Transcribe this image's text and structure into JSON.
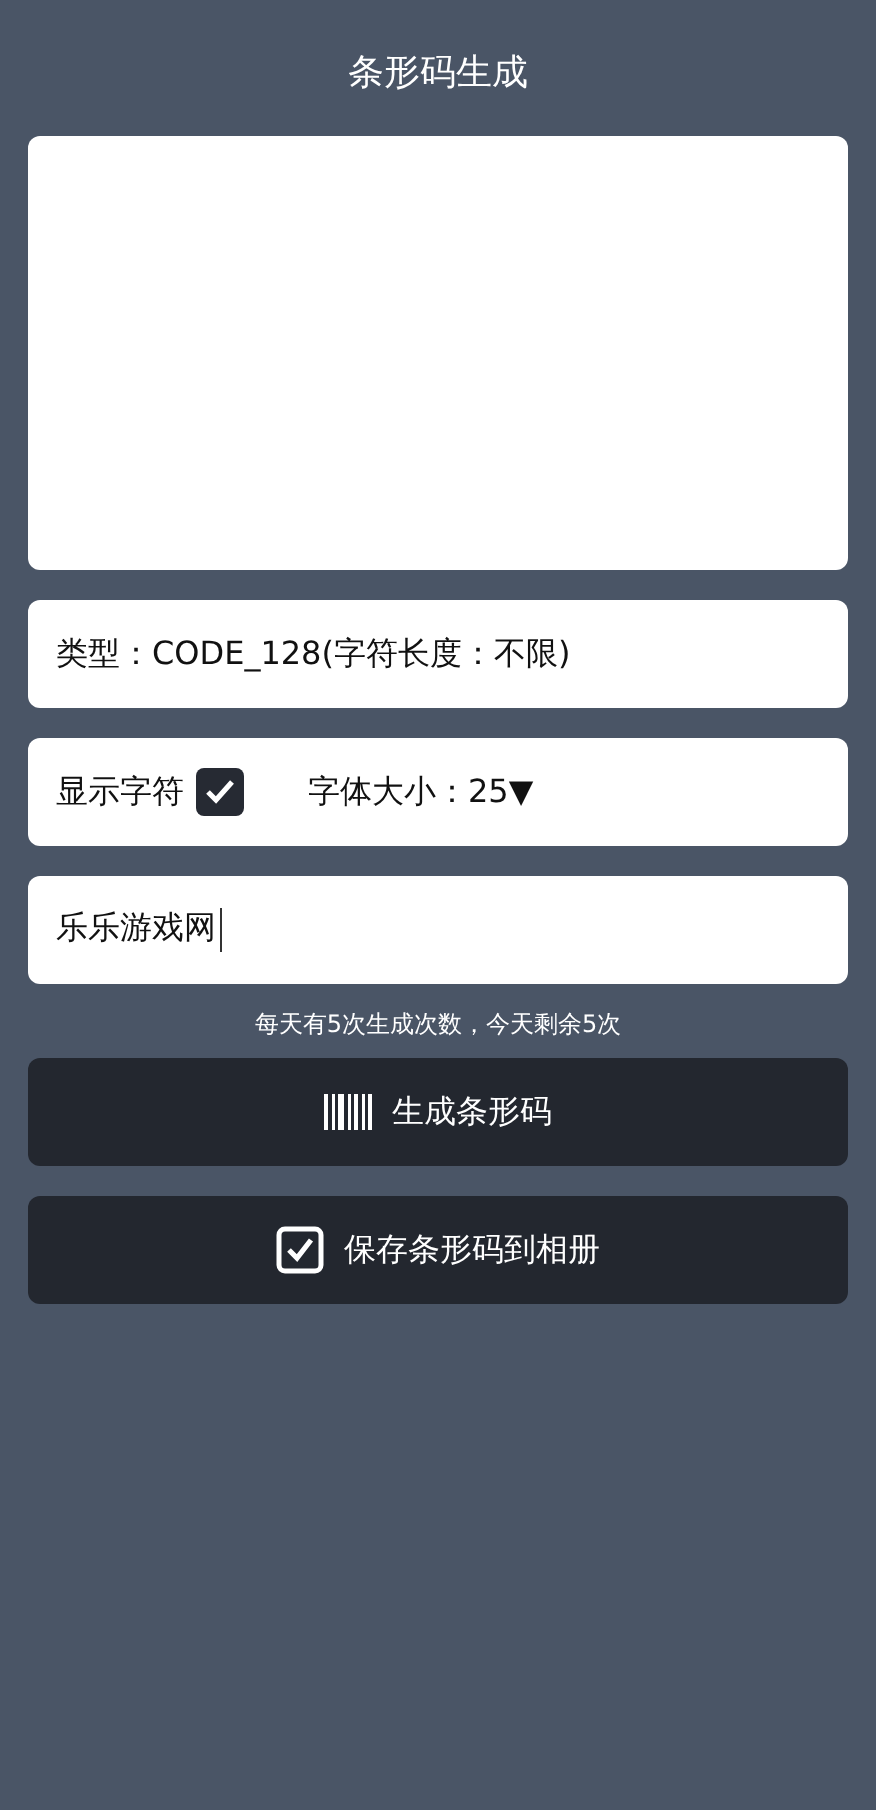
{
  "header": {
    "title": "条形码生成"
  },
  "barcode_type": {
    "text": "类型：CODE_128(字符长度：不限)"
  },
  "options": {
    "show_text_label": "显示字符",
    "show_text_checked": true,
    "font_size_label": "字体大小：",
    "font_size_value": "25",
    "font_size_caret": "▼"
  },
  "content_input": {
    "value": "乐乐游戏网"
  },
  "quota_note": "每天有5次生成次数，今天剩余5次",
  "buttons": [
    {
      "kind": "generate",
      "label": "生成条形码"
    },
    {
      "kind": "save",
      "label": "保存条形码到相册"
    }
  ]
}
